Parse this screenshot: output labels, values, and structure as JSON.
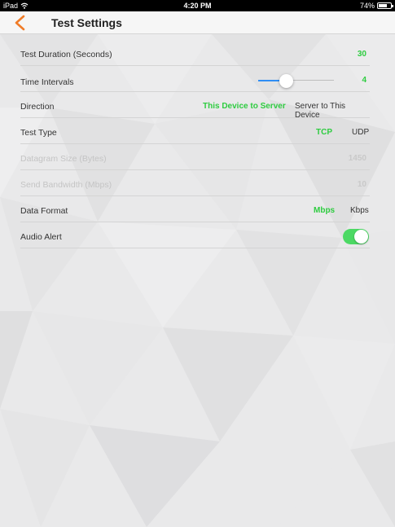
{
  "status_bar": {
    "device": "iPad",
    "time": "4:20 PM",
    "battery_percent": "74%",
    "battery_level": 0.74
  },
  "nav": {
    "title": "Test Settings"
  },
  "settings": {
    "test_duration": {
      "label": "Test Duration (Seconds)",
      "value": "30"
    },
    "time_intervals": {
      "label": "Time Intervals",
      "value": "4",
      "slider_level": 0.37
    },
    "direction": {
      "label": "Direction",
      "options": [
        "This Device to Server",
        "Server to This Device"
      ],
      "selected": "This Device to Server"
    },
    "test_type": {
      "label": "Test Type",
      "options": [
        "TCP",
        "UDP"
      ],
      "selected": "TCP"
    },
    "datagram_size": {
      "label": "Datagram Size (Bytes)",
      "value": "1450"
    },
    "send_bandwidth": {
      "label": "Send Bandwidth (Mbps)",
      "value": "10"
    },
    "data_format": {
      "label": "Data Format",
      "options": [
        "Mbps",
        "Kbps"
      ],
      "selected": "Mbps"
    },
    "audio_alert": {
      "label": "Audio Alert",
      "enabled": true
    }
  },
  "colors": {
    "accent_green": "#2ecc40",
    "back_arrow": "#f07c28",
    "slider_blue": "#2f8ef4",
    "toggle_on": "#4cd964"
  }
}
